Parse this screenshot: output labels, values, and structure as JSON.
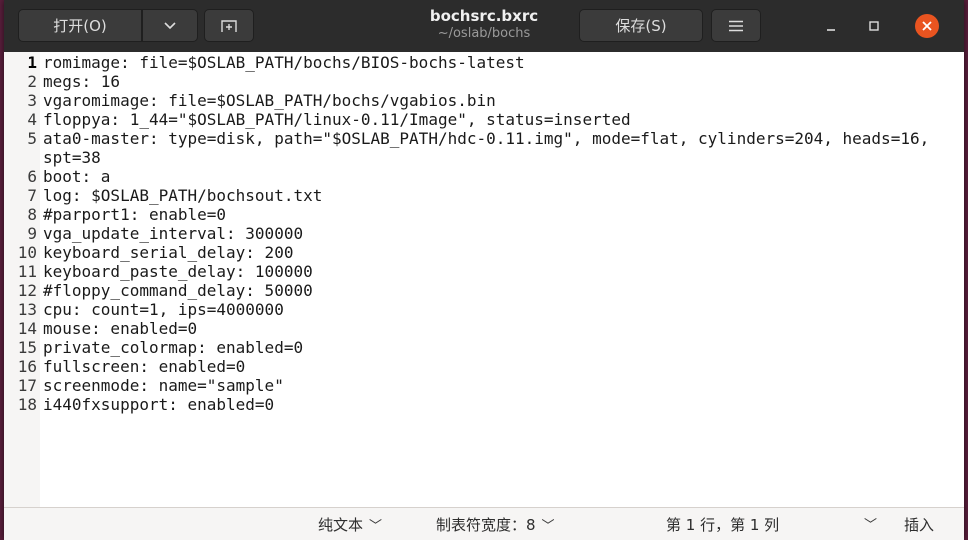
{
  "header": {
    "open_label": "打开(O)",
    "save_label": "保存(S)",
    "title": "bochsrc.bxrc",
    "subtitle": "~/oslab/bochs"
  },
  "icons": {
    "open_arrow": "chevron-down-icon",
    "new_tab": "new-tab-icon",
    "menu": "hamburger-menu-icon",
    "minimize": "minimize-icon",
    "maximize": "maximize-icon",
    "close": "close-icon"
  },
  "colors": {
    "headerbar": "#2c2c2c",
    "close_button": "#e95420",
    "editor_bg": "#ffffff",
    "gutter_bg": "#f6f5f4"
  },
  "editor": {
    "current_line": 1,
    "lines": [
      {
        "num": "1",
        "text": "romimage: file=$OSLAB_PATH/bochs/BIOS-bochs-latest"
      },
      {
        "num": "2",
        "text": "megs: 16"
      },
      {
        "num": "3",
        "text": "vgaromimage: file=$OSLAB_PATH/bochs/vgabios.bin"
      },
      {
        "num": "4",
        "text": "floppya: 1_44=\"$OSLAB_PATH/linux-0.11/Image\", status=inserted"
      },
      {
        "num": "5",
        "text": "ata0-master: type=disk, path=\"$OSLAB_PATH/hdc-0.11.img\", mode=flat, cylinders=204, heads=16, spt=38"
      },
      {
        "num": "6",
        "text": "boot: a"
      },
      {
        "num": "7",
        "text": "log: $OSLAB_PATH/bochsout.txt"
      },
      {
        "num": "8",
        "text": "#parport1: enable=0"
      },
      {
        "num": "9",
        "text": "vga_update_interval: 300000"
      },
      {
        "num": "10",
        "text": "keyboard_serial_delay: 200"
      },
      {
        "num": "11",
        "text": "keyboard_paste_delay: 100000"
      },
      {
        "num": "12",
        "text": "#floppy_command_delay: 50000"
      },
      {
        "num": "13",
        "text": "cpu: count=1, ips=4000000"
      },
      {
        "num": "14",
        "text": "mouse: enabled=0"
      },
      {
        "num": "15",
        "text": "private_colormap: enabled=0"
      },
      {
        "num": "16",
        "text": "fullscreen: enabled=0"
      },
      {
        "num": "17",
        "text": "screenmode: name=\"sample\""
      },
      {
        "num": "18",
        "text": "i440fxsupport: enabled=0"
      }
    ]
  },
  "statusbar": {
    "language": "纯文本",
    "tab_width": "制表符宽度：8",
    "position": "第 1 行，第 1 列",
    "insert_mode": "插入"
  }
}
